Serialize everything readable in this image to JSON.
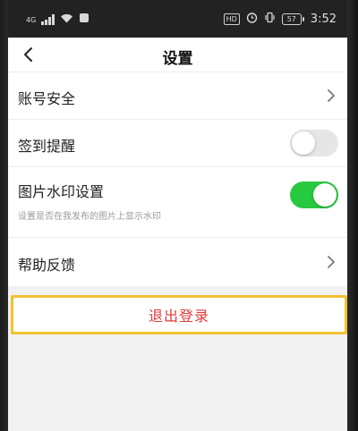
{
  "status_bar": {
    "signal_label": "4G",
    "time": "3:52",
    "battery": "57",
    "hd_label": "HD"
  },
  "header": {
    "title": "设置"
  },
  "settings": {
    "account_security": "账号安全",
    "checkin_reminder": "签到提醒",
    "checkin_reminder_enabled": false,
    "watermark": "图片水印设置",
    "watermark_desc": "设置是否在我发布的图片上显示水印",
    "watermark_enabled": true,
    "help_feedback": "帮助反馈"
  },
  "logout": {
    "label": "退出登录"
  },
  "colors": {
    "toggle_on": "#27c93f",
    "toggle_off": "#e6e6e6",
    "logout_text": "#e03a3a",
    "logout_border": "#f1c231"
  }
}
